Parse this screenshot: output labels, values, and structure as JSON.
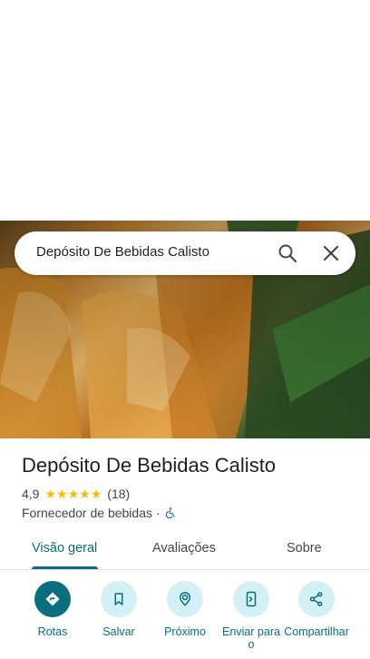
{
  "search": {
    "query": "Depósito De Bebidas Calisto"
  },
  "place": {
    "name": "Depósito De Bebidas Calisto",
    "rating": "4,9",
    "stars": 5,
    "review_count": "(18)",
    "category": "Fornecedor de bebidas",
    "separator": "·"
  },
  "tabs": [
    {
      "label": "Visão geral",
      "active": true
    },
    {
      "label": "Avaliações",
      "active": false
    },
    {
      "label": "Sobre",
      "active": false
    }
  ],
  "actions": [
    {
      "label": "Rotas",
      "icon": "directions-icon"
    },
    {
      "label": "Salvar",
      "icon": "bookmark-icon"
    },
    {
      "label": "Próximo",
      "icon": "nearby-icon"
    },
    {
      "label": "Enviar para o",
      "icon": "send-to-phone-icon"
    },
    {
      "label": "Compartilhar",
      "icon": "share-icon"
    }
  ],
  "colors": {
    "accent": "#0b6e7e",
    "accent_light": "#d3f1f4",
    "star": "#fbbc04"
  }
}
